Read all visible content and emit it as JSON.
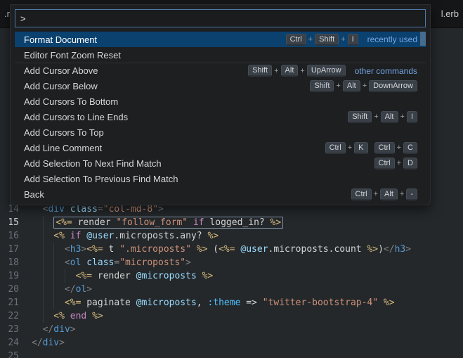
{
  "window": {
    "left_tab_fragment": ".rb",
    "right_tab_fragment": "l.erb"
  },
  "palette": {
    "input_value": ">",
    "plus_separator": "+",
    "items": [
      {
        "label": "Format Document",
        "chords": [
          [
            "Ctrl",
            "Shift",
            "I"
          ]
        ],
        "group": "recently used",
        "selected": true
      },
      {
        "label": "Editor Font Zoom Reset",
        "chords": []
      },
      {
        "label": "Add Cursor Above",
        "chords": [
          [
            "Shift",
            "Alt",
            "UpArrow"
          ]
        ],
        "group": "other commands",
        "groupStart": true
      },
      {
        "label": "Add Cursor Below",
        "chords": [
          [
            "Shift",
            "Alt",
            "DownArrow"
          ]
        ]
      },
      {
        "label": "Add Cursors To Bottom",
        "chords": []
      },
      {
        "label": "Add Cursors to Line Ends",
        "chords": [
          [
            "Shift",
            "Alt",
            "I"
          ]
        ]
      },
      {
        "label": "Add Cursors To Top",
        "chords": []
      },
      {
        "label": "Add Line Comment",
        "chords": [
          [
            "Ctrl",
            "K"
          ],
          [
            "Ctrl",
            "C"
          ]
        ]
      },
      {
        "label": "Add Selection To Next Find Match",
        "chords": [
          [
            "Ctrl",
            "D"
          ]
        ]
      },
      {
        "label": "Add Selection To Previous Find Match",
        "chords": []
      },
      {
        "label": "Back",
        "chords": [
          [
            "Ctrl",
            "Alt",
            "-"
          ]
        ]
      }
    ]
  },
  "editor": {
    "active_line": 15,
    "lines": [
      {
        "n": 14,
        "indent": "  ",
        "tokens": [
          [
            "<",
            "punct"
          ],
          [
            "div",
            "tag"
          ],
          [
            " ",
            "plain"
          ],
          [
            "class",
            "attr"
          ],
          [
            "=",
            "punct"
          ],
          [
            "\"col-md-8\"",
            "str"
          ],
          [
            ">",
            "punct"
          ]
        ]
      },
      {
        "n": 15,
        "active": true,
        "boxed": true,
        "indent": "    ",
        "tokens": [
          [
            "<%=",
            "erb"
          ],
          [
            " render ",
            "plain"
          ],
          [
            "\"follow_form\"",
            "str"
          ],
          [
            " ",
            "plain"
          ],
          [
            "if",
            "kw"
          ],
          [
            " logged_in? ",
            "plain"
          ],
          [
            "%>",
            "erb"
          ]
        ]
      },
      {
        "n": 16,
        "indent": "    ",
        "tokens": [
          [
            "<%",
            "erb"
          ],
          [
            " ",
            "plain"
          ],
          [
            "if",
            "kw"
          ],
          [
            " ",
            "plain"
          ],
          [
            "@user",
            "ivar"
          ],
          [
            ".microposts.any? ",
            "plain"
          ],
          [
            "%>",
            "erb"
          ]
        ]
      },
      {
        "n": 17,
        "indent": "      ",
        "tokens": [
          [
            "<",
            "punct"
          ],
          [
            "h3",
            "tag"
          ],
          [
            ">",
            "punct"
          ],
          [
            "<%=",
            "erb"
          ],
          [
            " t ",
            "plain"
          ],
          [
            "\".microposts\"",
            "str"
          ],
          [
            " ",
            "plain"
          ],
          [
            "%>",
            "erb"
          ],
          [
            " (",
            "plain"
          ],
          [
            "<%=",
            "erb"
          ],
          [
            " ",
            "plain"
          ],
          [
            "@user",
            "ivar"
          ],
          [
            ".microposts.count ",
            "plain"
          ],
          [
            "%>",
            "erb"
          ],
          [
            ")",
            "plain"
          ],
          [
            "</",
            "punct"
          ],
          [
            "h3",
            "tag"
          ],
          [
            ">",
            "punct"
          ]
        ]
      },
      {
        "n": 18,
        "indent": "      ",
        "tokens": [
          [
            "<",
            "punct"
          ],
          [
            "ol",
            "tag"
          ],
          [
            " ",
            "plain"
          ],
          [
            "class",
            "attr"
          ],
          [
            "=",
            "punct"
          ],
          [
            "\"microposts\"",
            "str"
          ],
          [
            ">",
            "punct"
          ]
        ]
      },
      {
        "n": 19,
        "indent": "        ",
        "tokens": [
          [
            "<%=",
            "erb"
          ],
          [
            " render ",
            "plain"
          ],
          [
            "@microposts",
            "ivar"
          ],
          [
            " ",
            "plain"
          ],
          [
            "%>",
            "erb"
          ]
        ]
      },
      {
        "n": 20,
        "indent": "      ",
        "tokens": [
          [
            "</",
            "punct"
          ],
          [
            "ol",
            "tag"
          ],
          [
            ">",
            "punct"
          ]
        ]
      },
      {
        "n": 21,
        "indent": "      ",
        "tokens": [
          [
            "<%=",
            "erb"
          ],
          [
            " paginate ",
            "plain"
          ],
          [
            "@microposts",
            "ivar"
          ],
          [
            ", ",
            "plain"
          ],
          [
            ":theme",
            "sym"
          ],
          [
            " => ",
            "plain"
          ],
          [
            "\"twitter-bootstrap-4\"",
            "str"
          ],
          [
            " ",
            "plain"
          ],
          [
            "%>",
            "erb"
          ]
        ]
      },
      {
        "n": 22,
        "indent": "    ",
        "tokens": [
          [
            "<%",
            "erb"
          ],
          [
            " ",
            "plain"
          ],
          [
            "end",
            "kw"
          ],
          [
            " ",
            "plain"
          ],
          [
            "%>",
            "erb"
          ]
        ]
      },
      {
        "n": 23,
        "indent": "  ",
        "tokens": [
          [
            "</",
            "punct"
          ],
          [
            "div",
            "tag"
          ],
          [
            ">",
            "punct"
          ]
        ]
      },
      {
        "n": 24,
        "indent": "",
        "tokens": [
          [
            "</",
            "punct"
          ],
          [
            "div",
            "tag"
          ],
          [
            ">",
            "punct"
          ]
        ]
      },
      {
        "n": 25,
        "indent": "",
        "tokens": []
      }
    ]
  },
  "colors": {
    "selected_row_blue": "#0a416e",
    "group_label_blue": "#76a5e3",
    "editor_background": "#24282b",
    "palette_background": "#1d1f21",
    "string_orange": "#ce9178",
    "keyword_purple": "#c586c0",
    "tag_blue": "#569cd6",
    "erb_delimiter_gold": "#d7ba7d"
  }
}
